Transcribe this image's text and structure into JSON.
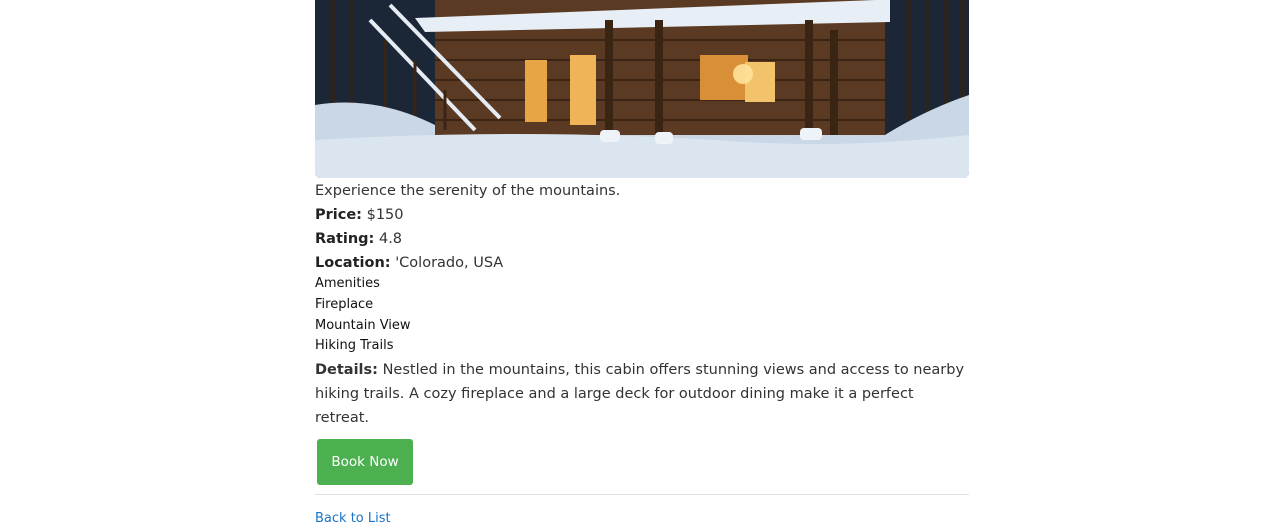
{
  "listing": {
    "description": "Experience the serenity of the mountains.",
    "price_label": "Price:",
    "price": "$150",
    "rating_label": "Rating:",
    "rating": "4.8",
    "location_label": "Location:",
    "location": "'Colorado, USA",
    "amenities_title": "Amenities",
    "amenities": [
      "Fireplace",
      "Mountain View",
      "Hiking Trails"
    ],
    "details_label": "Details:",
    "details": "Nestled in the mountains, this cabin offers stunning views and access to nearby hiking trails. A cozy fireplace and a large deck for outdoor dining make it a perfect retreat."
  },
  "actions": {
    "book_label": "Book Now",
    "back_label": "Back to List"
  },
  "colors": {
    "button": "#4caf50",
    "link": "#1a73c8"
  }
}
